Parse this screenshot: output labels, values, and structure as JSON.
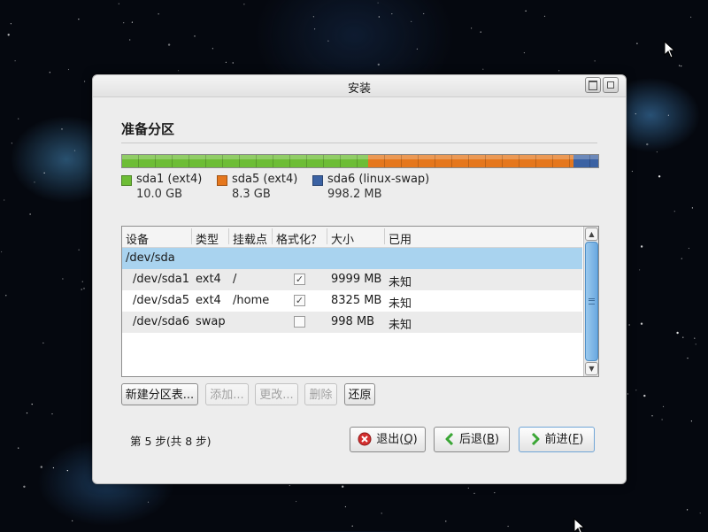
{
  "dialog": {
    "title": "安装",
    "heading": "准备分区",
    "step_label": "第 5 步(共 8 步)"
  },
  "partition_bar": [
    {
      "name": "sda1 (ext4)",
      "size": "10.0 GB",
      "color": "#6dbd35",
      "size_mb": 9999
    },
    {
      "name": "sda5 (ext4)",
      "size": "8.3 GB",
      "color": "#e5771d",
      "size_mb": 8325
    },
    {
      "name": "sda6 (linux-swap)",
      "size": "998.2 MB",
      "color": "#3b62a3",
      "size_mb": 998
    }
  ],
  "table": {
    "columns": [
      "设备",
      "类型",
      "挂载点",
      "格式化？",
      "大小",
      "已用"
    ],
    "group_row": "/dev/sda",
    "rows": [
      {
        "device": "/dev/sda1",
        "type": "ext4",
        "mount": "/",
        "format": true,
        "size": "9999 MB",
        "used": "未知"
      },
      {
        "device": "/dev/sda5",
        "type": "ext4",
        "mount": "/home",
        "format": true,
        "size": "8325 MB",
        "used": "未知"
      },
      {
        "device": "/dev/sda6",
        "type": "swap",
        "mount": "",
        "format": false,
        "size": "998 MB",
        "used": "未知"
      }
    ]
  },
  "actions": {
    "new_table": "新建分区表...",
    "add": "添加...",
    "change": "更改...",
    "delete": "删除",
    "revert": "还原"
  },
  "nav": {
    "quit": {
      "label": "退出(",
      "key": "Q",
      "end": ")"
    },
    "back": {
      "label": "后退(",
      "key": "B",
      "end": ")"
    },
    "forward": {
      "label": "前进(",
      "key": "F",
      "end": ")"
    }
  },
  "icons": {
    "quit": "close-circle-icon",
    "back": "arrow-left-icon",
    "forward": "arrow-right-icon"
  },
  "colors": {
    "selection": "#a9d3ef",
    "quit_icon": "#d32f2f",
    "nav_icon": "#3aa635"
  }
}
